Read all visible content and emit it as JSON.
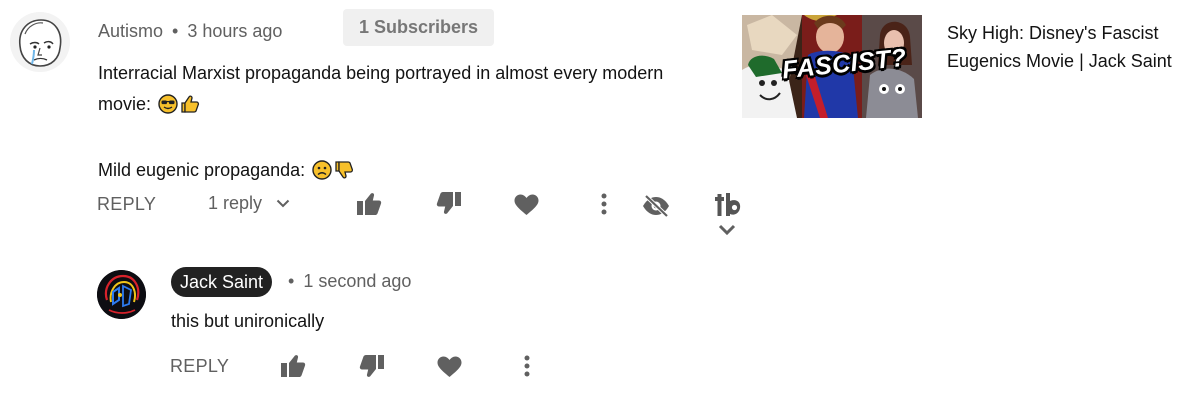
{
  "top_comment": {
    "author": "Autismo",
    "separator": "•",
    "time": "3 hours ago",
    "subscribers_badge": "1 Subscribers",
    "line1": "Interracial Marxist propaganda being portrayed in almost every modern",
    "line2": "movie:",
    "line3": "Mild eugenic propaganda:",
    "line2_emojis": [
      "sunglasses-face",
      "thumbs-up"
    ],
    "line3_emojis": [
      "frowning-face",
      "thumbs-down"
    ],
    "actions": {
      "reply_label": "REPLY",
      "replies_label": "1 reply",
      "icons": [
        "like-icon",
        "dislike-icon",
        "heart-icon",
        "more-vert-icon",
        "hide-icon",
        "tubebuddy-icon",
        "chevron-down-icon"
      ]
    }
  },
  "video": {
    "thumbnail_text": "FASCIST?",
    "title": "Sky High: Disney's Fascist Eugenics Movie | Jack Saint"
  },
  "reply_comment": {
    "author": "Jack Saint",
    "separator": "•",
    "time": "1 second ago",
    "text": "this but unironically",
    "actions": {
      "reply_label": "REPLY",
      "icons": [
        "like-icon",
        "dislike-icon",
        "heart-icon",
        "more-vert-icon"
      ]
    }
  },
  "colors": {
    "meta_text": "#606060",
    "icon": "#606060",
    "badge_bg": "#f0f0f0",
    "author_chip_bg": "#222222",
    "emoji_yellow": "#f7c02b"
  }
}
